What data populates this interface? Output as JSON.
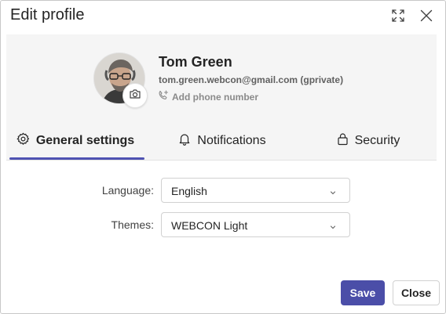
{
  "dialog": {
    "title": "Edit profile",
    "header_buttons": [
      "expand-icon",
      "close-icon"
    ]
  },
  "profile": {
    "name": "Tom Green",
    "email": "tom.green.webcon@gmail.com (gprivate)",
    "phone_link": "Add phone number",
    "icons": [
      "camera-icon",
      "phone-add-icon"
    ]
  },
  "tabs": [
    {
      "label": "General settings",
      "icon": "gear-icon",
      "active": true
    },
    {
      "label": "Notifications",
      "icon": "bell-icon",
      "active": false
    },
    {
      "label": "Security",
      "icon": "lock-icon",
      "active": false
    }
  ],
  "form": {
    "language": {
      "label": "Language:",
      "value": "English"
    },
    "themes": {
      "label": "Themes:",
      "value": "WEBCON Light"
    }
  },
  "footer": {
    "save_label": "Save",
    "close_label": "Close"
  },
  "colors": {
    "accent": "#4f52b2",
    "save_button": "#4b4ea8",
    "panel_background": "#f5f5f5"
  }
}
